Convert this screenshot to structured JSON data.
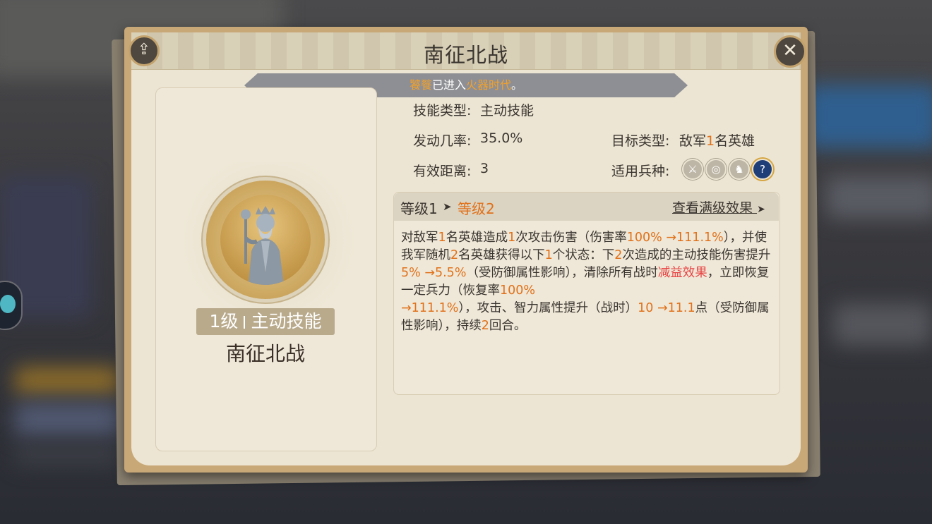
{
  "dialog": {
    "title": "南征北战"
  },
  "notice": {
    "name": "饕餮",
    "mid": "已进入",
    "era": "火器时代",
    "end": "。"
  },
  "skill": {
    "level_label": "1级",
    "type_badge": "主动技能",
    "name": "南征北战"
  },
  "info": {
    "skill_type_label": "技能类型:",
    "skill_type_value": "主动技能",
    "trigger_label": "发动几率:",
    "trigger_value": "35.0%",
    "target_label": "目标类型:",
    "target_value_a": "敌军",
    "target_value_num": "1",
    "target_value_b": "名英雄",
    "range_label": "有效距离:",
    "range_value": "3",
    "troop_label": "适用兵种:",
    "troop_icons": [
      "sword-icon",
      "target-icon",
      "horse-icon",
      "question-icon"
    ]
  },
  "levels": {
    "from": "等级1",
    "to": "等级2",
    "max_link": "查看满级效果"
  },
  "description": [
    {
      "t": "对敌军",
      "c": ""
    },
    {
      "t": "1",
      "c": "hl"
    },
    {
      "t": "名英雄造成",
      "c": ""
    },
    {
      "t": "1",
      "c": "hl"
    },
    {
      "t": "次攻击伤害（伤害率",
      "c": ""
    },
    {
      "t": "100% →111.1%",
      "c": "hl"
    },
    {
      "t": "），并使我军随机",
      "c": ""
    },
    {
      "t": "2",
      "c": "hl"
    },
    {
      "t": "名英雄获得以下",
      "c": ""
    },
    {
      "t": "1",
      "c": "hl"
    },
    {
      "t": "个状态：下",
      "c": ""
    },
    {
      "t": "2",
      "c": "hl"
    },
    {
      "t": "次造成的主动技能伤害提升",
      "c": ""
    },
    {
      "t": "5% →5.5%",
      "c": "hl"
    },
    {
      "t": "（受防御属性影响），清除所有战时",
      "c": ""
    },
    {
      "t": "减益效果",
      "c": "red"
    },
    {
      "t": "，立即恢复一定兵力（恢复率",
      "c": ""
    },
    {
      "t": "100% →111.1%",
      "c": "hl"
    },
    {
      "t": "），攻击、智力属性提升（战时）",
      "c": ""
    },
    {
      "t": "10 →11.1",
      "c": "hl"
    },
    {
      "t": "点（受防御属性影响），持续",
      "c": ""
    },
    {
      "t": "2",
      "c": "hl"
    },
    {
      "t": "回合。",
      "c": ""
    }
  ],
  "colors": {
    "highlight": "#e0711a",
    "debuff": "#e84343",
    "notice_accent": "#f3a12a"
  }
}
